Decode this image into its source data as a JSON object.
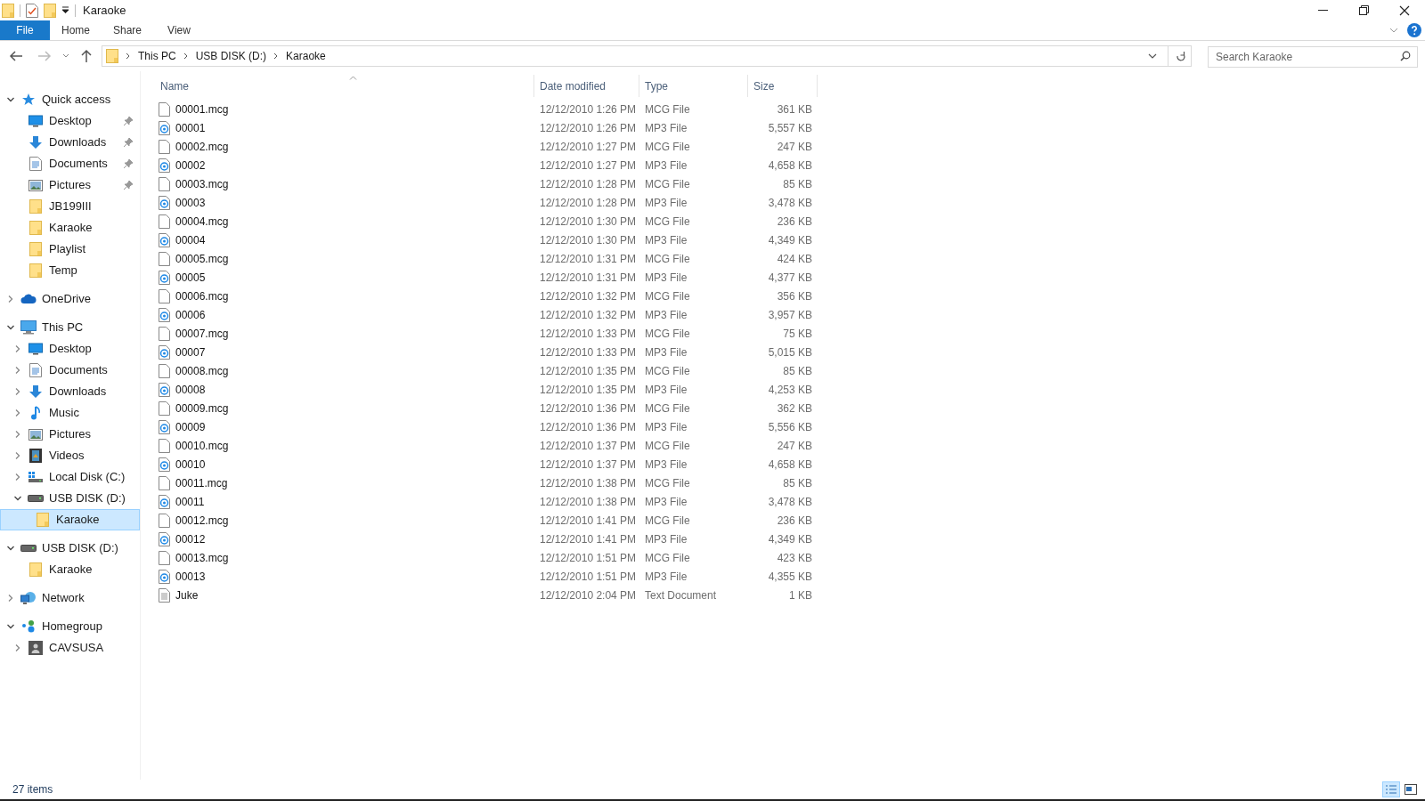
{
  "window": {
    "title": "Karaoke"
  },
  "ribbon_tabs": [
    {
      "label": "File",
      "selected": true
    },
    {
      "label": "Home",
      "selected": false
    },
    {
      "label": "Share",
      "selected": false
    },
    {
      "label": "View",
      "selected": false
    }
  ],
  "breadcrumb": [
    "This PC",
    "USB DISK (D:)",
    "Karaoke"
  ],
  "search": {
    "placeholder": "Search Karaoke"
  },
  "sidebar": [
    {
      "label": "Quick access",
      "kind": "star",
      "expanded": true,
      "selected": false,
      "children": [
        {
          "label": "Desktop",
          "kind": "desktop",
          "pinned": true,
          "selected": false
        },
        {
          "label": "Downloads",
          "kind": "download",
          "pinned": true,
          "selected": false
        },
        {
          "label": "Documents",
          "kind": "document",
          "pinned": true,
          "selected": false
        },
        {
          "label": "Pictures",
          "kind": "picture",
          "pinned": true,
          "selected": false
        },
        {
          "label": "JB199III",
          "kind": "folder",
          "pinned": false,
          "selected": false
        },
        {
          "label": "Karaoke",
          "kind": "folder",
          "pinned": false,
          "selected": false
        },
        {
          "label": "Playlist",
          "kind": "folder",
          "pinned": false,
          "selected": false
        },
        {
          "label": "Temp",
          "kind": "folder",
          "pinned": false,
          "selected": false
        }
      ]
    },
    {
      "label": "OneDrive",
      "kind": "cloud",
      "expanded": false,
      "selected": false
    },
    {
      "label": "This PC",
      "kind": "computer",
      "expanded": true,
      "selected": false,
      "children": [
        {
          "label": "Desktop",
          "kind": "desktop",
          "expanded": false,
          "selected": false
        },
        {
          "label": "Documents",
          "kind": "document",
          "expanded": false,
          "selected": false
        },
        {
          "label": "Downloads",
          "kind": "download",
          "expanded": false,
          "selected": false
        },
        {
          "label": "Music",
          "kind": "music",
          "expanded": false,
          "selected": false
        },
        {
          "label": "Pictures",
          "kind": "picture",
          "expanded": false,
          "selected": false
        },
        {
          "label": "Videos",
          "kind": "video",
          "expanded": false,
          "selected": false
        },
        {
          "label": "Local Disk (C:)",
          "kind": "windisk",
          "expanded": false,
          "selected": false
        },
        {
          "label": "USB DISK (D:)",
          "kind": "drive",
          "expanded": true,
          "selected": false,
          "children": [
            {
              "label": "Karaoke",
              "kind": "folder",
              "selected": true
            }
          ]
        }
      ]
    },
    {
      "label": "USB DISK (D:)",
      "kind": "drive",
      "expanded": true,
      "selected": false,
      "children": [
        {
          "label": "Karaoke",
          "kind": "folder",
          "selected": false
        }
      ]
    },
    {
      "label": "Network",
      "kind": "network",
      "expanded": false,
      "selected": false
    },
    {
      "label": "Homegroup",
      "kind": "homegroup",
      "expanded": true,
      "selected": false,
      "children": [
        {
          "label": "CAVSUSA",
          "kind": "user",
          "expanded": false,
          "selected": false
        }
      ]
    }
  ],
  "columns": [
    "Name",
    "Date modified",
    "Type",
    "Size"
  ],
  "files": [
    {
      "name": "00001.mcg",
      "date": "12/12/2010 1:26 PM",
      "type": "MCG File",
      "size": "361 KB",
      "kind": "blank"
    },
    {
      "name": "00001",
      "date": "12/12/2010 1:26 PM",
      "type": "MP3 File",
      "size": "5,557 KB",
      "kind": "audio"
    },
    {
      "name": "00002.mcg",
      "date": "12/12/2010 1:27 PM",
      "type": "MCG File",
      "size": "247 KB",
      "kind": "blank"
    },
    {
      "name": "00002",
      "date": "12/12/2010 1:27 PM",
      "type": "MP3 File",
      "size": "4,658 KB",
      "kind": "audio"
    },
    {
      "name": "00003.mcg",
      "date": "12/12/2010 1:28 PM",
      "type": "MCG File",
      "size": "85 KB",
      "kind": "blank"
    },
    {
      "name": "00003",
      "date": "12/12/2010 1:28 PM",
      "type": "MP3 File",
      "size": "3,478 KB",
      "kind": "audio"
    },
    {
      "name": "00004.mcg",
      "date": "12/12/2010 1:30 PM",
      "type": "MCG File",
      "size": "236 KB",
      "kind": "blank"
    },
    {
      "name": "00004",
      "date": "12/12/2010 1:30 PM",
      "type": "MP3 File",
      "size": "4,349 KB",
      "kind": "audio"
    },
    {
      "name": "00005.mcg",
      "date": "12/12/2010 1:31 PM",
      "type": "MCG File",
      "size": "424 KB",
      "kind": "blank"
    },
    {
      "name": "00005",
      "date": "12/12/2010 1:31 PM",
      "type": "MP3 File",
      "size": "4,377 KB",
      "kind": "audio"
    },
    {
      "name": "00006.mcg",
      "date": "12/12/2010 1:32 PM",
      "type": "MCG File",
      "size": "356 KB",
      "kind": "blank"
    },
    {
      "name": "00006",
      "date": "12/12/2010 1:32 PM",
      "type": "MP3 File",
      "size": "3,957 KB",
      "kind": "audio"
    },
    {
      "name": "00007.mcg",
      "date": "12/12/2010 1:33 PM",
      "type": "MCG File",
      "size": "75 KB",
      "kind": "blank"
    },
    {
      "name": "00007",
      "date": "12/12/2010 1:33 PM",
      "type": "MP3 File",
      "size": "5,015 KB",
      "kind": "audio"
    },
    {
      "name": "00008.mcg",
      "date": "12/12/2010 1:35 PM",
      "type": "MCG File",
      "size": "85 KB",
      "kind": "blank"
    },
    {
      "name": "00008",
      "date": "12/12/2010 1:35 PM",
      "type": "MP3 File",
      "size": "4,253 KB",
      "kind": "audio"
    },
    {
      "name": "00009.mcg",
      "date": "12/12/2010 1:36 PM",
      "type": "MCG File",
      "size": "362 KB",
      "kind": "blank"
    },
    {
      "name": "00009",
      "date": "12/12/2010 1:36 PM",
      "type": "MP3 File",
      "size": "5,556 KB",
      "kind": "audio"
    },
    {
      "name": "00010.mcg",
      "date": "12/12/2010 1:37 PM",
      "type": "MCG File",
      "size": "247 KB",
      "kind": "blank"
    },
    {
      "name": "00010",
      "date": "12/12/2010 1:37 PM",
      "type": "MP3 File",
      "size": "4,658 KB",
      "kind": "audio"
    },
    {
      "name": "00011.mcg",
      "date": "12/12/2010 1:38 PM",
      "type": "MCG File",
      "size": "85 KB",
      "kind": "blank"
    },
    {
      "name": "00011",
      "date": "12/12/2010 1:38 PM",
      "type": "MP3 File",
      "size": "3,478 KB",
      "kind": "audio"
    },
    {
      "name": "00012.mcg",
      "date": "12/12/2010 1:41 PM",
      "type": "MCG File",
      "size": "236 KB",
      "kind": "blank"
    },
    {
      "name": "00012",
      "date": "12/12/2010 1:41 PM",
      "type": "MP3 File",
      "size": "4,349 KB",
      "kind": "audio"
    },
    {
      "name": "00013.mcg",
      "date": "12/12/2010 1:51 PM",
      "type": "MCG File",
      "size": "423 KB",
      "kind": "blank"
    },
    {
      "name": "00013",
      "date": "12/12/2010 1:51 PM",
      "type": "MP3 File",
      "size": "4,355 KB",
      "kind": "audio"
    },
    {
      "name": "Juke",
      "date": "12/12/2010 2:04 PM",
      "type": "Text Document",
      "size": "1 KB",
      "kind": "text"
    }
  ],
  "status_bar": {
    "item_count": "27 items"
  }
}
